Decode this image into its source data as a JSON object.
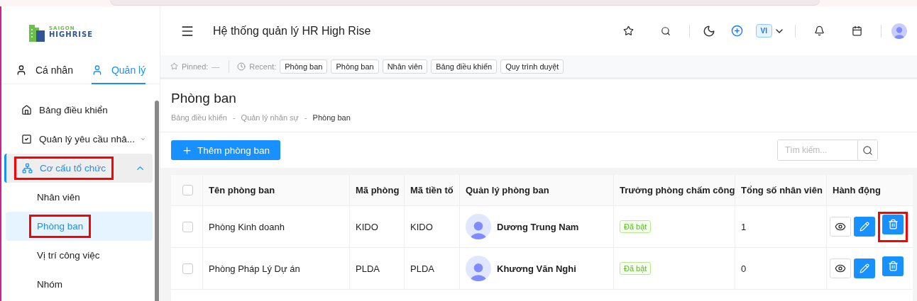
{
  "logo": {
    "line1": "SAIGON",
    "line2": "HIGHRISE"
  },
  "sidebar_tabs": [
    {
      "label": "Cá nhân",
      "selected": false
    },
    {
      "label": "Quản lý",
      "selected": true
    }
  ],
  "sidebar_menu": [
    {
      "label": "Bảng điều khiển",
      "selected": false,
      "highlighted": false
    },
    {
      "label": "Quản lý yêu cầu nhâ...",
      "selected": false,
      "expanded": false,
      "highlighted": false
    },
    {
      "label": "Cơ cấu tổ chức",
      "selected": true,
      "expanded": true,
      "highlighted": true,
      "children": [
        {
          "label": "Nhân viên",
          "selected": false,
          "highlighted": false
        },
        {
          "label": "Phòng ban",
          "selected": true,
          "highlighted": true
        },
        {
          "label": "Vị trí công việc",
          "selected": false,
          "highlighted": false
        },
        {
          "label": "Nhóm",
          "selected": false,
          "highlighted": false
        }
      ]
    }
  ],
  "header": {
    "title": "Hệ thống quản lý HR High Rise",
    "language": "VI"
  },
  "quick_bar": {
    "pinned_label": "Pinned:",
    "pinned_value": "—",
    "recent_label": "Recent:",
    "recent": [
      "Phòng ban",
      "Phòng ban",
      "Nhân viên",
      "Bảng điều khiển",
      "Quy trình duyệt"
    ]
  },
  "page": {
    "title": "Phòng ban",
    "breadcrumb": [
      "Bảng điều khiển",
      "Quản lý nhân sự",
      "Phòng ban"
    ],
    "breadcrumb_separator": "-",
    "add_button": "Thêm phòng ban",
    "search": {
      "placeholder": "Tìm kiếm..."
    }
  },
  "table": {
    "all_selected": false,
    "columns": [
      "Tên phòng ban",
      "Mã phòng",
      "Mã tiền tố",
      "Quản lý phòng ban",
      "Trưởng phòng chấm công",
      "Tổng số nhân viên",
      "Hành động"
    ],
    "rows": [
      {
        "selected": false,
        "name": "Phòng Kinh doanh",
        "code": "KIDO",
        "prefix": "KIDO",
        "manager": "Dương Trung Nam",
        "timekeeping": "Đã bật",
        "total": "1",
        "delete_highlighted": true
      },
      {
        "selected": false,
        "name": "Phòng Pháp Lý Dự án",
        "code": "PLDA",
        "prefix": "PLDA",
        "manager": "Khương Văn Nghi",
        "timekeeping": "Đã bật",
        "total": "0",
        "delete_highlighted": false
      }
    ]
  }
}
